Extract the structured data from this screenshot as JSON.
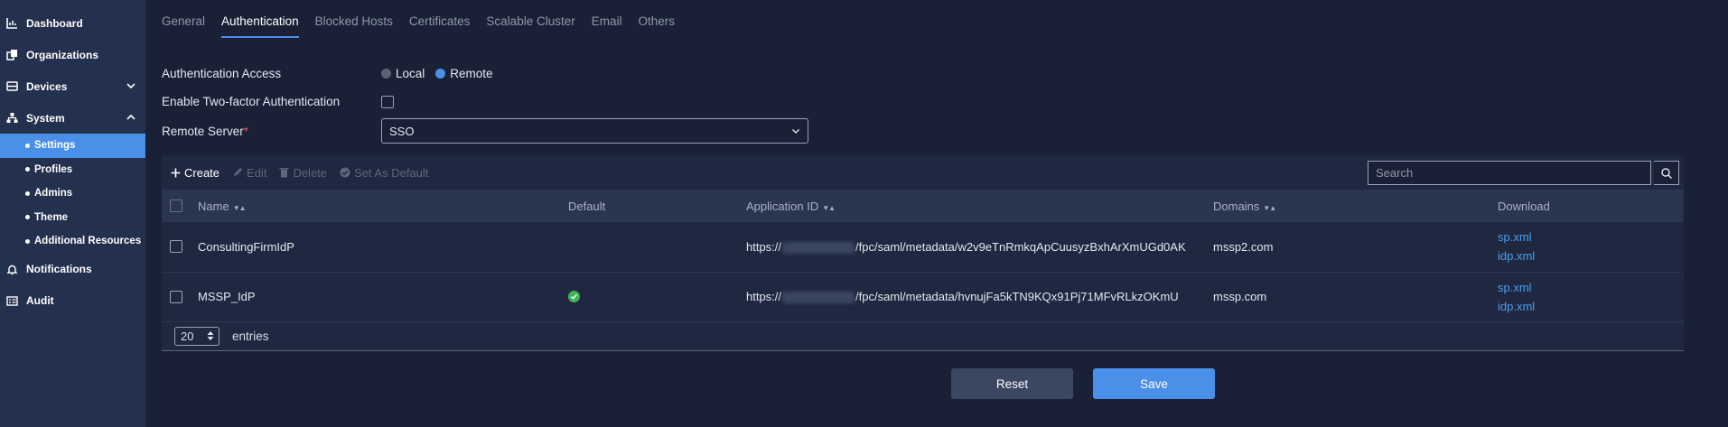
{
  "sidebar": {
    "items": [
      {
        "label": "Dashboard",
        "icon": "chart-icon"
      },
      {
        "label": "Organizations",
        "icon": "organizations-icon"
      },
      {
        "label": "Devices",
        "icon": "devices-icon"
      },
      {
        "label": "System",
        "icon": "sitemap-icon"
      },
      {
        "label": "Notifications",
        "icon": "bell-icon"
      },
      {
        "label": "Audit",
        "icon": "audit-icon"
      }
    ],
    "system_sub": [
      {
        "label": "Settings"
      },
      {
        "label": "Profiles"
      },
      {
        "label": "Admins"
      },
      {
        "label": "Theme"
      },
      {
        "label": "Additional Resources"
      }
    ]
  },
  "tabs": [
    "General",
    "Authentication",
    "Blocked Hosts",
    "Certificates",
    "Scalable Cluster",
    "Email",
    "Others"
  ],
  "form": {
    "auth_access_label": "Authentication Access",
    "radio_local": "Local",
    "radio_remote": "Remote",
    "two_factor_label": "Enable Two-factor Authentication",
    "remote_server_label": "Remote Server",
    "required_mark": "*",
    "remote_server_value": "SSO"
  },
  "toolbar": {
    "create": "Create",
    "edit": "Edit",
    "delete": "Delete",
    "set_default": "Set As Default",
    "search_placeholder": "Search"
  },
  "table": {
    "headers": {
      "name": "Name",
      "default": "Default",
      "app_id": "Application ID",
      "domains": "Domains",
      "download": "Download"
    },
    "rows": [
      {
        "name": "ConsultingFirmIdP",
        "app_prefix": "https://",
        "app_suffix": "/fpc/saml/metadata/w2v9eTnRmkqApCuusyzBxhArXmUGd0AK",
        "domain": "mssp2.com",
        "dl1": "sp.xml",
        "dl2": "idp.xml",
        "default": false
      },
      {
        "name": "MSSP_IdP",
        "app_prefix": "https://",
        "app_suffix": "/fpc/saml/metadata/hvnujFa5kTN9KQx91Pj71MFvRLkzOKmU",
        "domain": "mssp.com",
        "dl1": "sp.xml",
        "dl2": "idp.xml",
        "default": true
      }
    ],
    "entries_value": "20",
    "entries_label": "entries"
  },
  "actions": {
    "reset": "Reset",
    "save": "Save"
  },
  "colors": {
    "accent": "#4a8fe8",
    "sidebar_bg": "#23304e",
    "page_bg": "#1a2136",
    "success": "#3cb55a",
    "required": "#e05050"
  }
}
